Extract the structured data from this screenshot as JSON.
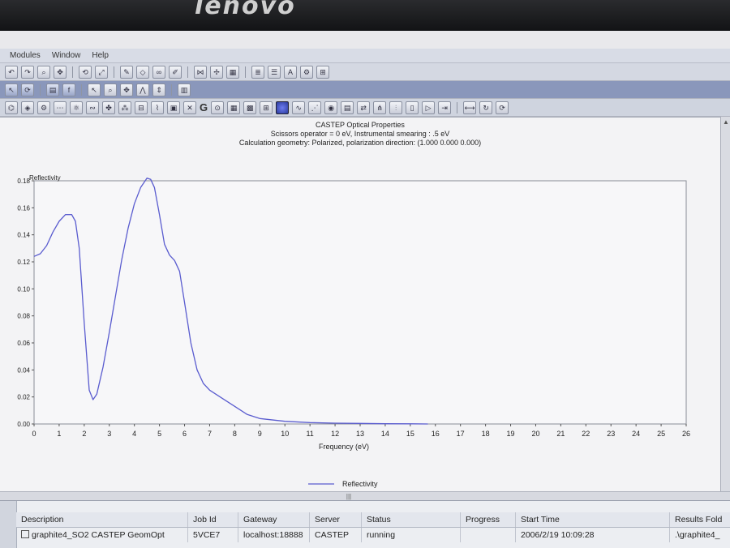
{
  "brand": "lenovo",
  "menu": [
    "Modules",
    "Window",
    "Help"
  ],
  "plot": {
    "title": "CASTEP Optical Properties",
    "subtitle1": "Scissors operator = 0 eV, Instrumental smearing : .5 eV",
    "subtitle2": "Calculation geometry: Polarized, polarization direction: (1.000 0.000 0.000)"
  },
  "chart_data": {
    "type": "line",
    "ylabel": "Reflectivity",
    "xlabel": "Frequency (eV)",
    "xlim": [
      0,
      26
    ],
    "ylim": [
      0,
      0.18
    ],
    "xticks": [
      "0",
      "1",
      "2",
      "3",
      "4",
      "5",
      "6",
      "7",
      "8",
      "9",
      "10",
      "11",
      "12",
      "13",
      "14",
      "15",
      "16",
      "17",
      "18",
      "19",
      "20",
      "21",
      "22",
      "23",
      "24",
      "25",
      "26"
    ],
    "yticks": [
      "0.00",
      "0.02",
      "0.04",
      "0.06",
      "0.08",
      "0.10",
      "0.12",
      "0.14",
      "0.16",
      "0.18"
    ],
    "legend": "Reflectivity",
    "series": [
      {
        "name": "Reflectivity",
        "color": "#5a5ccf",
        "x": [
          0,
          0.25,
          0.5,
          0.75,
          1.0,
          1.25,
          1.5,
          1.65,
          1.8,
          2.0,
          2.2,
          2.35,
          2.5,
          2.75,
          3.0,
          3.25,
          3.5,
          3.75,
          4.0,
          4.25,
          4.5,
          4.65,
          4.8,
          5.0,
          5.2,
          5.4,
          5.6,
          5.8,
          6.0,
          6.25,
          6.5,
          6.75,
          7.0,
          7.5,
          8.0,
          8.5,
          9.0,
          10.0,
          11.0,
          12.0,
          13.0,
          14.0,
          15.0,
          15.7
        ],
        "y": [
          0.124,
          0.126,
          0.132,
          0.142,
          0.15,
          0.155,
          0.155,
          0.15,
          0.13,
          0.075,
          0.025,
          0.018,
          0.022,
          0.042,
          0.068,
          0.095,
          0.122,
          0.145,
          0.163,
          0.175,
          0.182,
          0.181,
          0.175,
          0.155,
          0.133,
          0.125,
          0.121,
          0.113,
          0.09,
          0.06,
          0.04,
          0.03,
          0.025,
          0.019,
          0.013,
          0.007,
          0.004,
          0.002,
          0.001,
          0.0006,
          0.0004,
          0.0002,
          0.0001,
          0.0
        ]
      }
    ]
  },
  "jobs": {
    "columns": [
      "Description",
      "Job Id",
      "Gateway",
      "Server",
      "Status",
      "Progress",
      "Start Time",
      "Results Fold"
    ],
    "rows": [
      [
        "graphite4_SO2 CASTEP GeomOpt",
        "5VCE7",
        "localhost:18888",
        "CASTEP",
        "running",
        "",
        "2006/2/19 10:09:28",
        ".\\graphite4_"
      ]
    ]
  }
}
